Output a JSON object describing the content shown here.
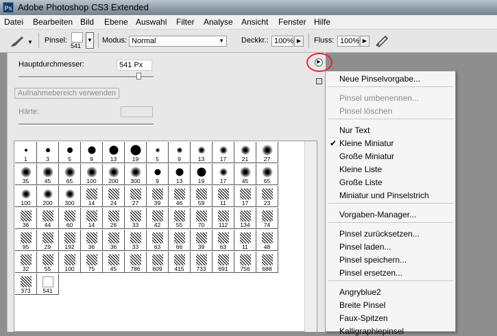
{
  "titlebar": {
    "app_icon": "Ps",
    "title": "Adobe Photoshop CS3 Extended"
  },
  "menubar": {
    "items": [
      "Datei",
      "Bearbeiten",
      "Bild",
      "Ebene",
      "Auswahl",
      "Filter",
      "Analyse",
      "Ansicht",
      "Fenster",
      "Hilfe"
    ]
  },
  "options": {
    "tool_icon": "brush-icon",
    "brush_label": "Pinsel:",
    "brush_size": "541",
    "mode_label": "Modus:",
    "mode_value": "Normal",
    "opacity_label": "Deckkr.:",
    "opacity_value": "100%",
    "flow_label": "Fluss:",
    "flow_value": "100%",
    "airbrush_icon": "airbrush-icon"
  },
  "panel": {
    "diameter_label": "Hauptdurchmesser:",
    "diameter_value": "541 Px",
    "sample_button": "Aufnahmebereich verwenden",
    "hardness_label": "Härte:",
    "hardness_value": "",
    "brushes": [
      "1",
      "3",
      "5",
      "9",
      "13",
      "19",
      "5",
      "9",
      "13",
      "17",
      "21",
      "27",
      "35",
      "45",
      "65",
      "100",
      "200",
      "300",
      "9",
      "13",
      "19",
      "17",
      "45",
      "65",
      "100",
      "200",
      "300",
      "14",
      "24",
      "27",
      "39",
      "46",
      "59",
      "11",
      "17",
      "23",
      "36",
      "44",
      "60",
      "14",
      "26",
      "33",
      "42",
      "55",
      "70",
      "112",
      "134",
      "74",
      "95",
      "29",
      "192",
      "36",
      "36",
      "33",
      "63",
      "66",
      "39",
      "63",
      "11",
      "48",
      "32",
      "55",
      "100",
      "75",
      "45",
      "786",
      "609",
      "415",
      "733",
      "691",
      "756",
      "688",
      "373",
      "541"
    ]
  },
  "menu": {
    "items": [
      {
        "label": "Neue Pinselvorgabe...",
        "enabled": true
      },
      {
        "label": "Pinsel umbenennen...",
        "enabled": false
      },
      {
        "label": "Pinsel löschen",
        "enabled": false
      },
      {
        "label": "Nur Text",
        "enabled": true
      },
      {
        "label": "Kleine Miniatur",
        "enabled": true,
        "checked": true
      },
      {
        "label": "Große Miniatur",
        "enabled": true
      },
      {
        "label": "Kleine Liste",
        "enabled": true
      },
      {
        "label": "Große Liste",
        "enabled": true
      },
      {
        "label": "Miniatur und Pinselstrich",
        "enabled": true
      },
      {
        "label": "Vorgaben-Manager...",
        "enabled": true
      },
      {
        "label": "Pinsel zurücksetzen...",
        "enabled": true
      },
      {
        "label": "Pinsel laden...",
        "enabled": true
      },
      {
        "label": "Pinsel speichern...",
        "enabled": true
      },
      {
        "label": "Pinsel ersetzen...",
        "enabled": true
      },
      {
        "label": "Angryblue2",
        "enabled": true
      },
      {
        "label": "Breite Pinsel",
        "enabled": true
      },
      {
        "label": "Faux-Spitzen",
        "enabled": true
      },
      {
        "label": "Kalligraphiepinsel",
        "enabled": true
      }
    ],
    "checkmark": "✔"
  },
  "colors": {
    "highlight_circle": "#e8242a",
    "menu_bg": "#f5f5f5",
    "panel_bg": "#e8e8e8"
  }
}
